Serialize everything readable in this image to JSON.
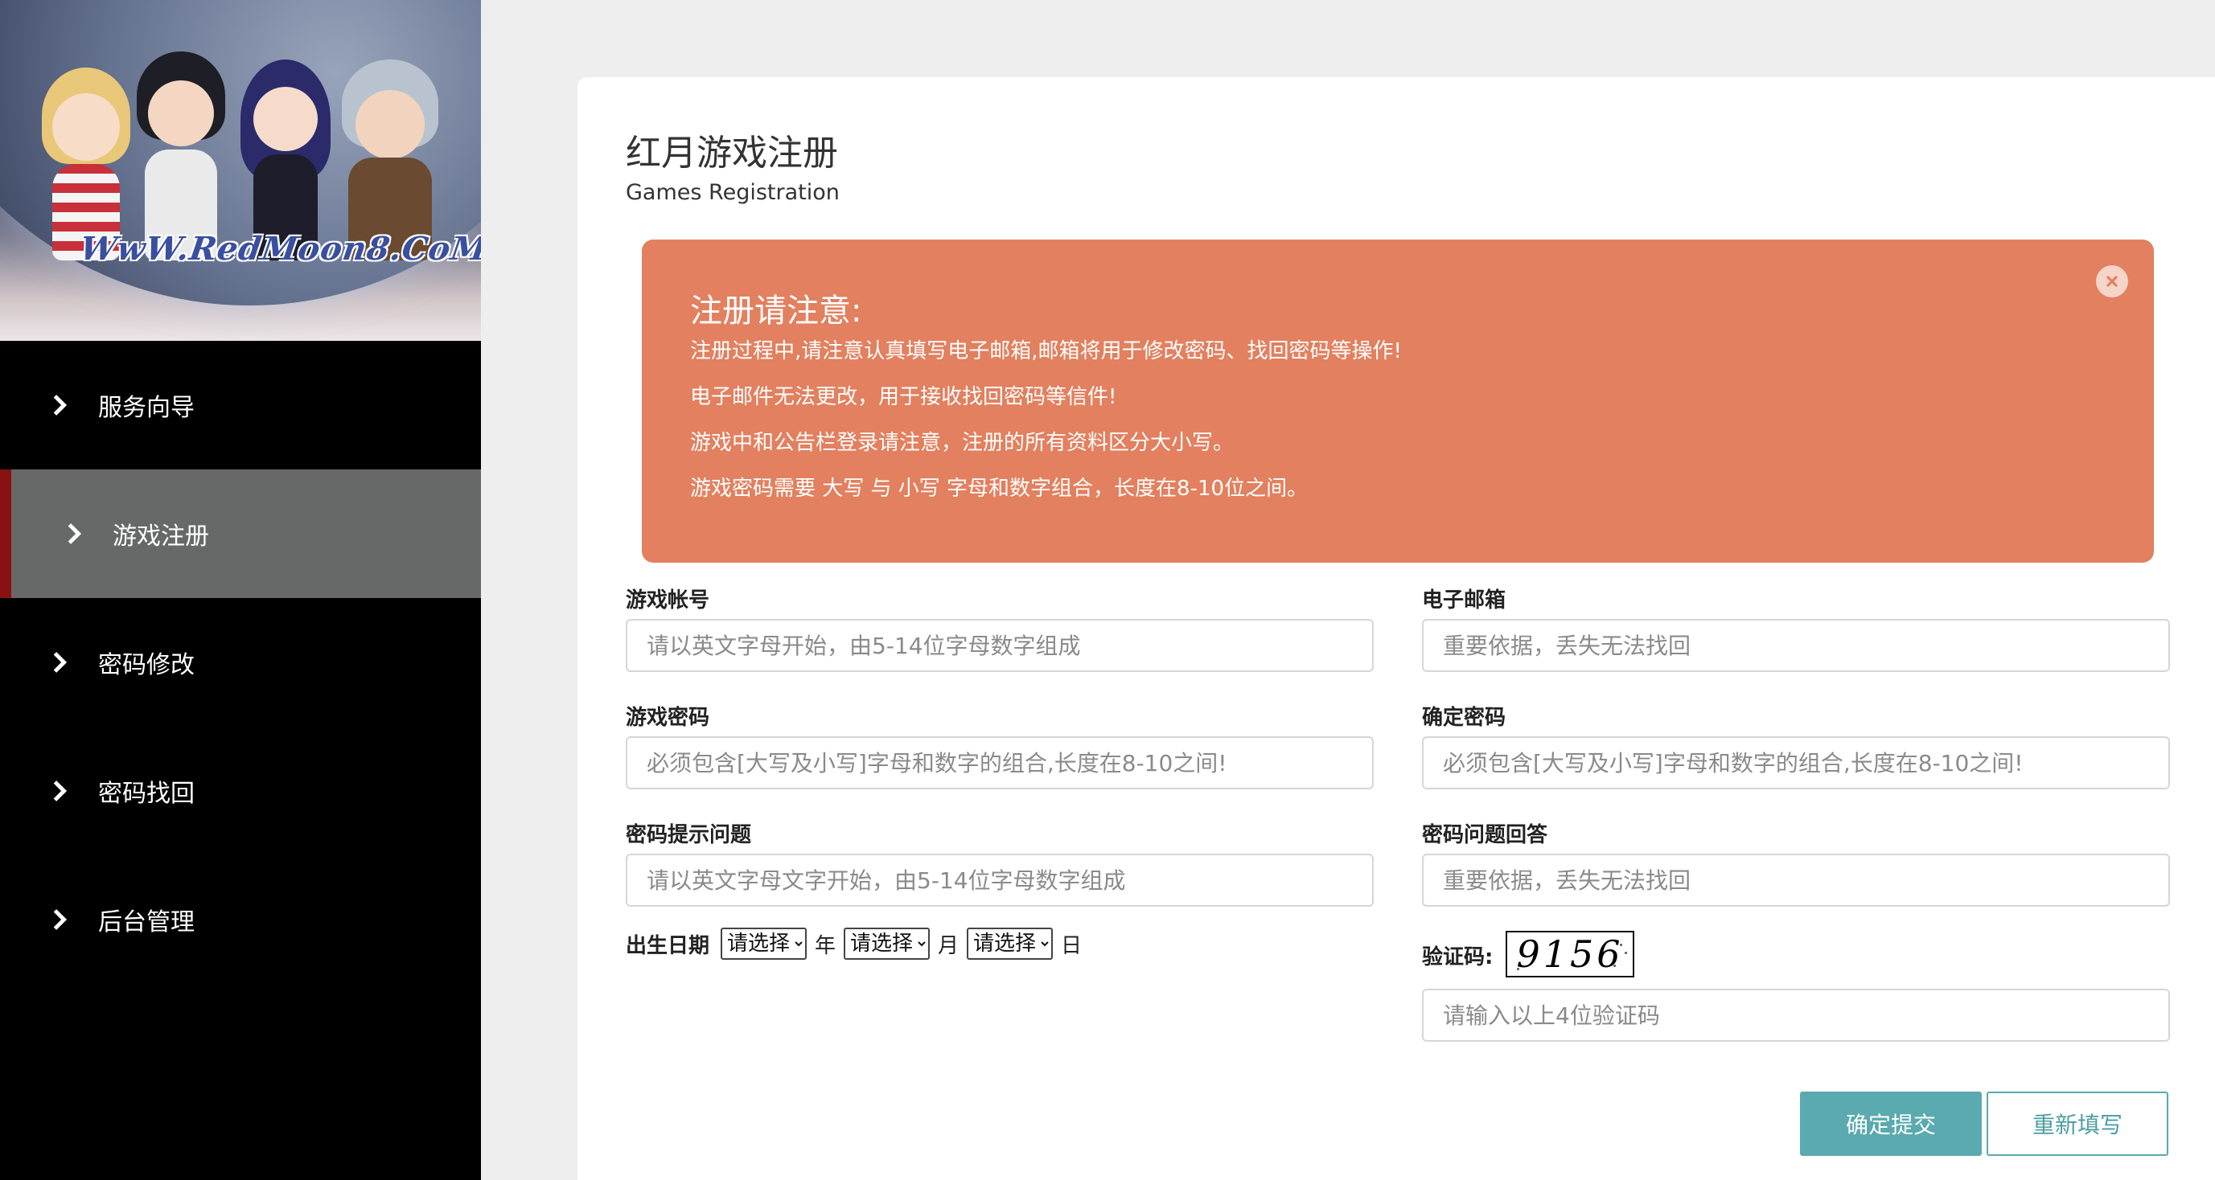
{
  "sidebar": {
    "banner_logo": "WwW.RedMoon8.CoM",
    "items": [
      {
        "label": "服务向导"
      },
      {
        "label": "游戏注册"
      },
      {
        "label": "密码修改"
      },
      {
        "label": "密码找回"
      },
      {
        "label": "后台管理"
      }
    ],
    "active_index": 1
  },
  "main": {
    "title": "红月游戏注册",
    "subtitle": "Games Registration",
    "alert": {
      "heading": "注册请注意:",
      "lines": [
        "注册过程中,请注意认真填写电子邮箱,邮箱将用于修改密码、找回密码等操作!",
        "电子邮件无法更改，用于接收找回密码等信件!",
        "游戏中和公告栏登录请注意，注册的所有资料区分大小写。",
        "游戏密码需要 大写 与 小写 字母和数字组合，长度在8-10位之间。"
      ],
      "color": "#e2805f"
    },
    "form": {
      "account": {
        "label": "游戏帐号",
        "placeholder": "请以英文字母开始，由5-14位字母数字组成"
      },
      "email": {
        "label": "电子邮箱",
        "placeholder": "重要依据，丢失无法找回"
      },
      "password": {
        "label": "游戏密码",
        "placeholder": "必须包含[大写及小写]字母和数字的组合,长度在8-10之间!"
      },
      "confirm_password": {
        "label": "确定密码",
        "placeholder": "必须包含[大写及小写]字母和数字的组合,长度在8-10之间!"
      },
      "question": {
        "label": "密码提示问题",
        "placeholder": "请以英文字母文字开始，由5-14位字母数字组成"
      },
      "answer": {
        "label": "密码问题回答",
        "placeholder": "重要依据，丢失无法找回"
      },
      "birth": {
        "label": "出生日期",
        "year_select": "请选择",
        "year_unit": "年",
        "month_select": "请选择",
        "month_unit": "月",
        "day_select": "请选择",
        "day_unit": "日"
      },
      "captcha": {
        "label": "验证码:",
        "code": "9156",
        "placeholder": "请输入以上4位验证码"
      }
    },
    "buttons": {
      "submit": "确定提交",
      "reset": "重新填写"
    },
    "colors": {
      "accent": "#5aaaaf",
      "sidebar_active": "#676968",
      "sidebar_active_marker": "#8a1111"
    }
  }
}
